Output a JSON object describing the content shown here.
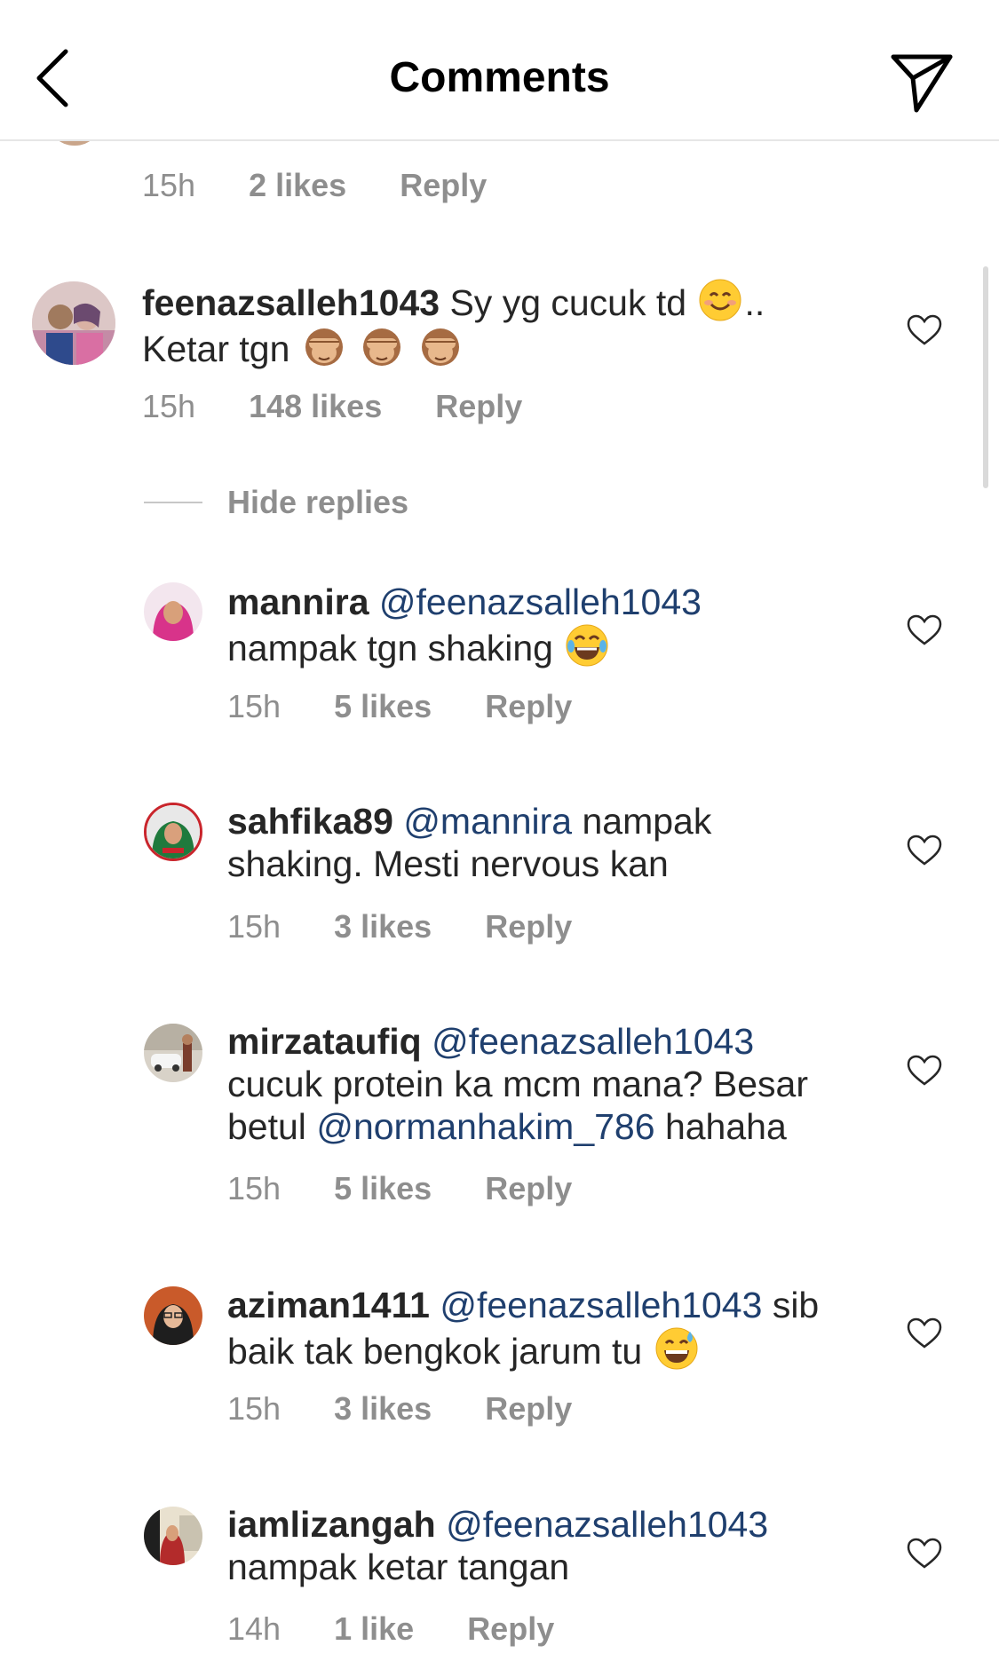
{
  "header": {
    "title": "Comments",
    "back_icon": "chevron-left-icon",
    "share_icon": "paper-plane-icon"
  },
  "previous_comment": {
    "time": "15h",
    "likes": "2 likes",
    "reply": "Reply"
  },
  "main_comment": {
    "username": "feenazsalleh1043",
    "text_part1": "Sy yg cucuk td",
    "text_part2": "..",
    "text_line2": "Ketar tgn",
    "time": "15h",
    "likes": "148 likes",
    "reply": "Reply"
  },
  "hide_replies": "Hide replies",
  "replies": [
    {
      "username": "mannira",
      "mention": "@feenazsalleh1043",
      "text": "nampak tgn shaking",
      "time": "15h",
      "likes": "5 likes",
      "reply": "Reply"
    },
    {
      "username": "sahfika89",
      "mention": "@mannira",
      "text_after_mention": "nampak",
      "text_line2": "shaking. Mesti nervous kan",
      "time": "15h",
      "likes": "3 likes",
      "reply": "Reply"
    },
    {
      "username": "mirzataufiq",
      "mention": "@feenazsalleh1043",
      "text_line2": "cucuk protein ka mcm mana? Besar",
      "text_line3_prefix": "betul",
      "mention2": "@normanhakim_786",
      "text_line3_suffix": "hahaha",
      "time": "15h",
      "likes": "5 likes",
      "reply": "Reply"
    },
    {
      "username": "aziman1411",
      "mention": "@feenazsalleh1043",
      "text_after_mention": "sib",
      "text_line2": "baik tak bengkok jarum tu",
      "time": "15h",
      "likes": "3 likes",
      "reply": "Reply"
    },
    {
      "username": "iamlizangah",
      "mention": "@feenazsalleh1043",
      "text_line2": "nampak ketar tangan",
      "time": "14h",
      "likes": "1 like",
      "reply": "Reply"
    }
  ],
  "colors": {
    "mention": "#1f3f6e",
    "meta": "#8e8e8e",
    "text": "#262626",
    "divider": "#e6e6e6"
  }
}
